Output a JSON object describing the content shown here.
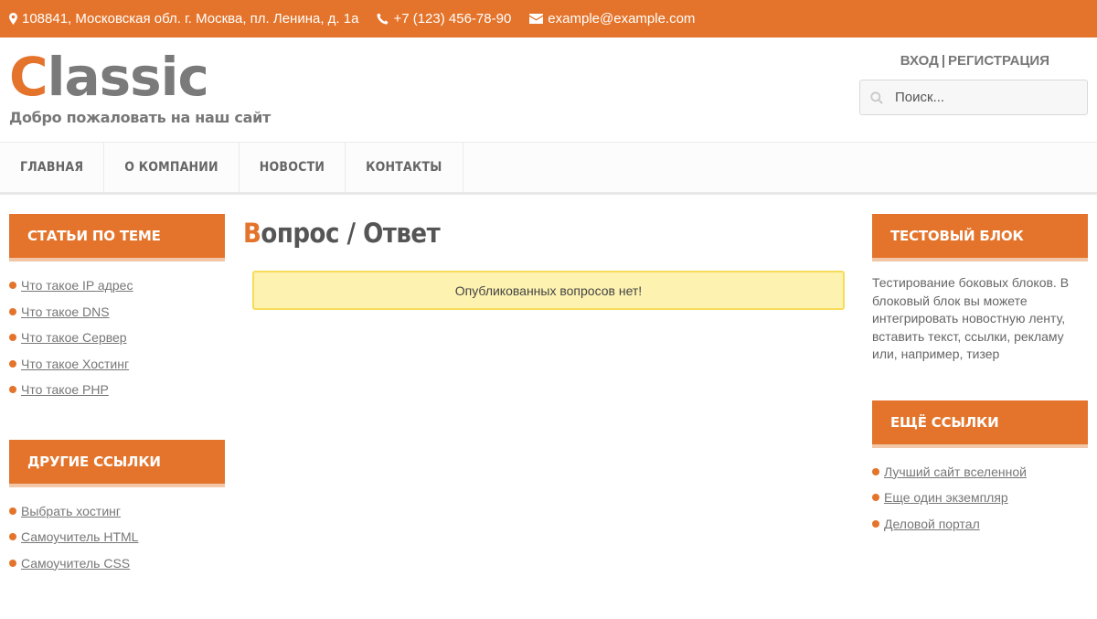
{
  "topbar": {
    "address": "108841, Московская обл. г. Москва, пл. Ленина, д. 1а",
    "phone": "+7 (123) 456-78-90",
    "email": "example@example.com"
  },
  "header": {
    "logo_first": "C",
    "logo_rest": "lassic",
    "slogan": "Добро пожаловать на наш сайт",
    "login": "ВХОД",
    "separator": "|",
    "register": "РЕГИСТРАЦИЯ",
    "search_placeholder": "Поиск..."
  },
  "nav": {
    "items": [
      "ГЛАВНАЯ",
      "О КОМПАНИИ",
      "НОВОСТИ",
      "КОНТАКТЫ"
    ]
  },
  "left_sidebar": {
    "blocks": [
      {
        "title": "СТАТЬИ ПО ТЕМЕ",
        "links": [
          "Что такое IP адрес",
          "Что такое DNS",
          "Что такое Сервер",
          "Что такое Хостинг",
          "Что такое PHP"
        ]
      },
      {
        "title": "ДРУГИЕ ССЫЛКИ",
        "links": [
          "Выбрать хостинг",
          "Самоучитель HTML",
          "Самоучитель CSS"
        ]
      }
    ]
  },
  "main": {
    "title_first": "В",
    "title_rest": "опрос / Ответ",
    "notice": "Опубликованных вопросов нет!"
  },
  "right_sidebar": {
    "blocks": [
      {
        "title": "ТЕСТОВЫЙ БЛОК",
        "text": "Тестирование боковых блоков. В блоковый блок вы можете интегрировать новостную ленту, вставить текст, ссылки, рекламу или, например, тизер"
      },
      {
        "title": "ЕЩЁ ССЫЛКИ",
        "links": [
          "Лучший сайт вселенной",
          "Еще один экземпляр",
          "Деловой портал"
        ]
      }
    ]
  },
  "colors": {
    "accent": "#e4742b",
    "notice_bg": "#fdf2b0",
    "notice_border": "#f7dc5a"
  }
}
